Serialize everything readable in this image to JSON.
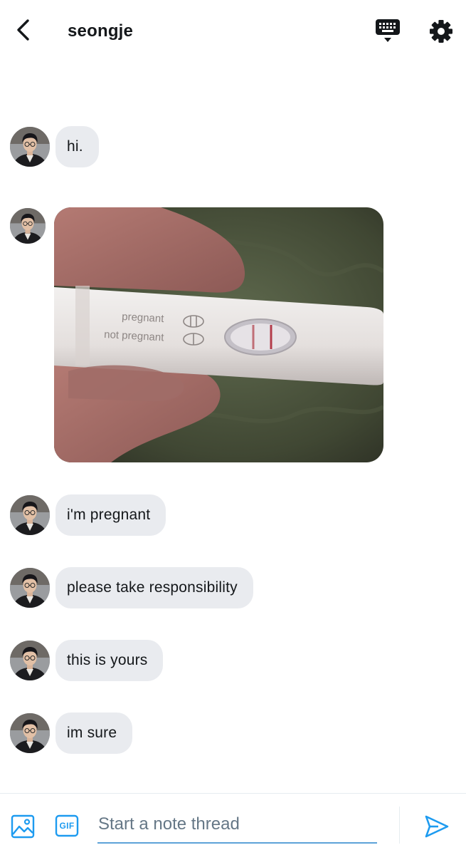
{
  "header": {
    "title": "seongje",
    "back_icon": "chevron-left-icon",
    "keyboard_icon": "keyboard-icon",
    "settings_icon": "gear-icon"
  },
  "messages": [
    {
      "type": "text",
      "text": "hi."
    },
    {
      "type": "image",
      "image_content": "pregnancy-test-photo",
      "test_labels": [
        "pregnant",
        "not pregnant"
      ]
    },
    {
      "type": "text",
      "text": "i'm pregnant"
    },
    {
      "type": "text",
      "text": "please take responsibility"
    },
    {
      "type": "text",
      "text": "this is yours"
    },
    {
      "type": "text",
      "text": "im sure"
    }
  ],
  "composer": {
    "placeholder": "Start a note thread",
    "value": "",
    "image_icon": "image-icon",
    "gif_label": "GIF",
    "send_icon": "send-icon"
  },
  "colors": {
    "accent": "#1d9bf0",
    "bubble": "#e9ebef",
    "text": "#14171a",
    "muted": "#657786"
  }
}
